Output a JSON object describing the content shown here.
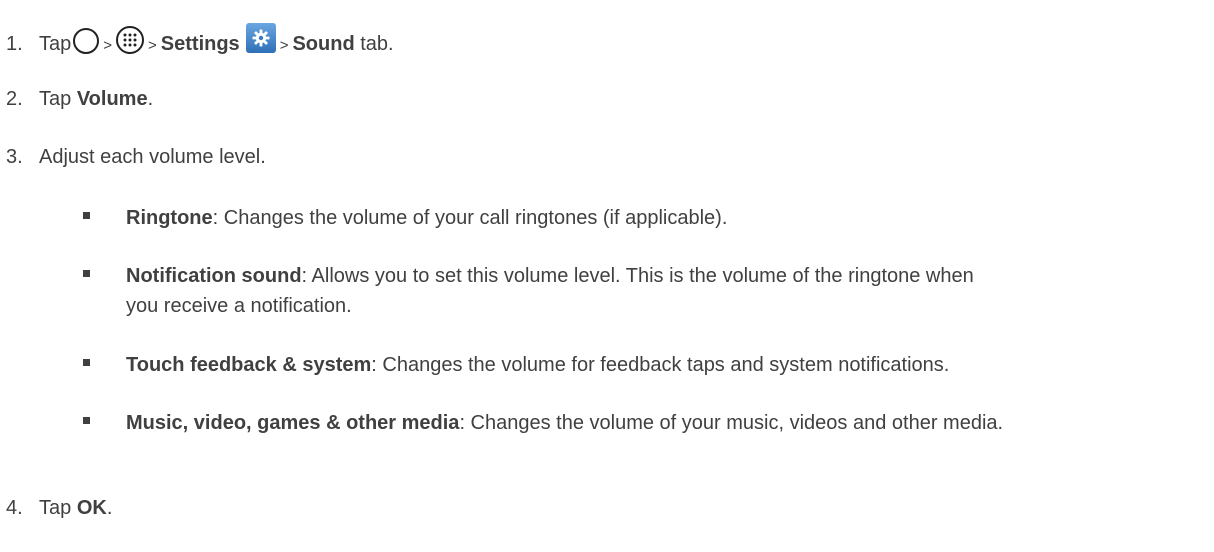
{
  "steps": [
    {
      "num": "1.",
      "tap": "Tap",
      "sep": ">",
      "settings": "Settings",
      "sound": "Sound",
      "tail": " tab."
    },
    {
      "num": "2.",
      "tap": "Tap ",
      "bold": "Volume",
      "tail": "."
    },
    {
      "num": "3.",
      "text": "Adjust each volume level."
    },
    {
      "num": "4.",
      "tap": "Tap ",
      "bold": "OK",
      "tail": "."
    }
  ],
  "items": [
    {
      "title": "Ringtone",
      "desc": ": Changes the volume of your call ringtones (if applicable)."
    },
    {
      "title": "Notification sound",
      "desc": ": Allows you to set this volume level. This is the volume of the ringtone when you receive a notification."
    },
    {
      "title": "Touch feedback & system",
      "desc": ": Changes the volume for feedback taps and system notifications."
    },
    {
      "title": "Music, video, games & other media",
      "desc": ": Changes the volume of your music, videos and other media."
    }
  ],
  "icons": {
    "home": "home-icon",
    "apps": "apps-icon",
    "settings": "settings-icon"
  },
  "colors": {
    "text": "#404040",
    "settings_icon": "#2f6fb7"
  }
}
